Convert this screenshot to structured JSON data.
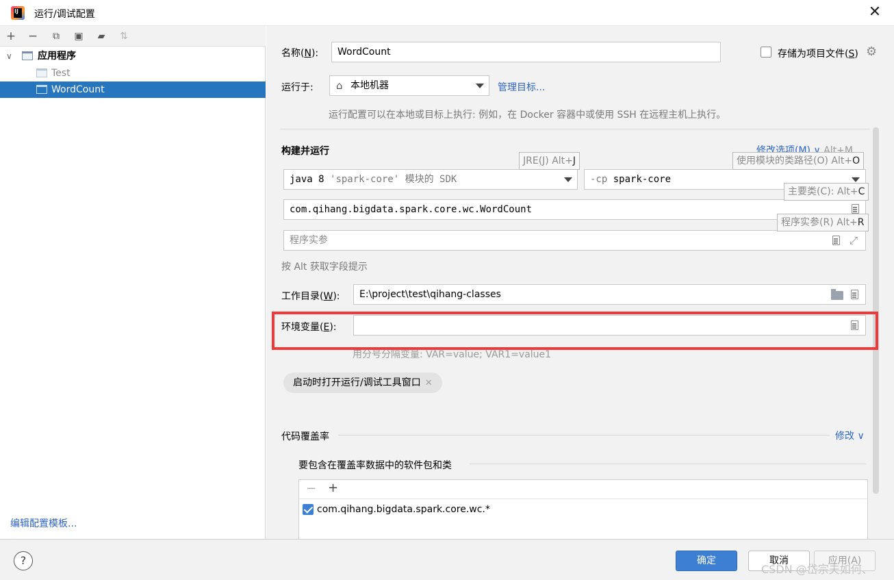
{
  "window": {
    "title": "运行/调试配置"
  },
  "sidebar": {
    "toolbar": [
      "add-icon",
      "remove-icon",
      "copy-icon",
      "save-icon",
      "new-folder-icon",
      "sort-icon"
    ],
    "tree": {
      "group": "应用程序",
      "items": [
        {
          "label": "Test",
          "selected": false
        },
        {
          "label": "WordCount",
          "selected": true
        }
      ]
    },
    "edit_templates": "编辑配置模板..."
  },
  "form": {
    "name_label": "名称(",
    "name_mn": "N",
    "name_label_end": "):",
    "name_value": "WordCount",
    "store_label": "存储为项目文件(",
    "store_mn": "S",
    "store_label_end": ")",
    "store_checked": false,
    "run_on_label": "运行于:",
    "run_on_value": "本地机器",
    "manage_targets": "管理目标...",
    "run_on_hint": "运行配置可以在本地或目标上执行: 例如，在 Docker 容器中或使用 SSH 在远程主机上执行。",
    "build_section": "构建并运行",
    "modify_options": "修改选项(M)",
    "modify_shortcut": "Alt+M",
    "jre_tip": "JRE(J) Alt+",
    "jre_tip_key": "J",
    "cp_tip": "使用模块的类路径(O) Alt+",
    "cp_tip_key": "O",
    "main_tip": "主要类(C): Alt+",
    "main_tip_key": "C",
    "args_tip": "程序实参(R) Alt+",
    "args_tip_key": "R",
    "sdk_java": "java 8",
    "sdk_module": "'spark-core'",
    "sdk_suffix": "模块的 SDK",
    "cp_flag": "-cp",
    "cp_value": "spark-core",
    "main_class": "com.qihang.bigdata.spark.core.wc.WordCount",
    "program_args_placeholder": "程序实参",
    "alt_hint": "按 Alt 获取字段提示",
    "workdir_label": "工作目录(",
    "workdir_mn": "W",
    "workdir_label_end": "):",
    "workdir_value": "E:\\project\\test\\qihang-classes",
    "env_label": "环境变量(",
    "env_mn": "E",
    "env_label_end": "):",
    "env_value": "",
    "env_hint": "用分号分隔变量: VAR=value; VAR1=value1",
    "open_tool_window_chip": "启动时打开运行/调试工具窗口",
    "coverage_section": "代码覆盖率",
    "coverage_modify": "修改",
    "coverage_sub": "要包含在覆盖率数据中的软件包和类",
    "coverage_items": [
      {
        "label": "com.qihang.bigdata.spark.core.wc.*",
        "checked": true
      }
    ]
  },
  "buttons": {
    "ok": "确定",
    "cancel": "取消",
    "apply": "应用(A)",
    "help": "?"
  },
  "watermark": "CSDN @岱宗夫如何、",
  "colors": {
    "accent": "#3d7fd3",
    "selection": "#2675bf",
    "link": "#2f65ca",
    "highlight_box": "#f03a3a"
  }
}
